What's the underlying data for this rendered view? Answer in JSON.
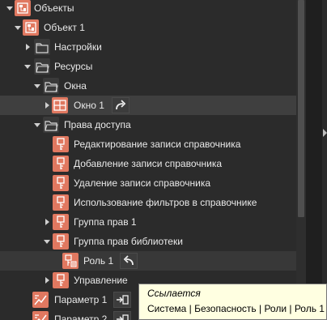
{
  "tree": {
    "rows": [
      {
        "label": "Объекты",
        "icon": "object-group-icon"
      },
      {
        "label": "Объект 1",
        "icon": "object-group-icon"
      },
      {
        "label": "Настройки",
        "icon": "folder-icon"
      },
      {
        "label": "Ресурсы",
        "icon": "folder-icon"
      },
      {
        "label": "Окна",
        "icon": "folder-icon"
      },
      {
        "label": "Окно 1",
        "icon": "window-grid-icon"
      },
      {
        "label": "Права доступа",
        "icon": "folder-icon"
      },
      {
        "label": "Редактирование записи справочника",
        "icon": "key-icon"
      },
      {
        "label": "Добавление записи справочника",
        "icon": "key-icon"
      },
      {
        "label": "Удаление записи справочника",
        "icon": "key-icon"
      },
      {
        "label": "Использование фильтров в справочнике",
        "icon": "key-icon"
      },
      {
        "label": "Группа прав 1",
        "icon": "key-icon"
      },
      {
        "label": "Группа прав библиотеки",
        "icon": "key-icon"
      },
      {
        "label": "Роль 1",
        "icon": "role-icon"
      },
      {
        "label": "Управление",
        "icon": "key-icon"
      },
      {
        "label": "Параметр 1",
        "icon": "parameter-icon"
      },
      {
        "label": "Параметр 2",
        "icon": "parameter-icon"
      }
    ]
  },
  "tooltip": {
    "title": "Ссылается",
    "path": "Система | Безопасность | Роли | Роль 1"
  },
  "colors": {
    "background": "#2b2b2b",
    "accent_icon": "#e07860",
    "selection": "#3f3f3f",
    "tooltip_bg": "#ffffe1"
  }
}
